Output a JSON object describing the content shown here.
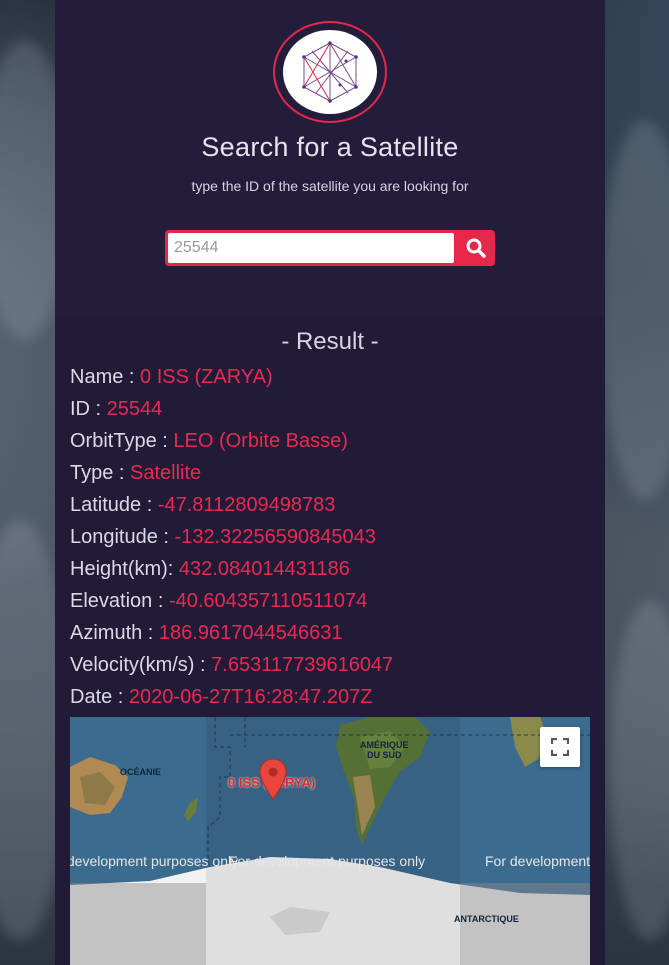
{
  "header": {
    "title": "Search for a Satellite",
    "subtitle": "type the ID of the satellite you are looking for"
  },
  "search": {
    "placeholder": "25544",
    "value": ""
  },
  "result": {
    "title": "- Result -",
    "fields": [
      {
        "key": "Name : ",
        "value": "0 ISS (ZARYA)"
      },
      {
        "key": "ID : ",
        "value": "25544"
      },
      {
        "key": "OrbitType : ",
        "value": "LEO (Orbite Basse)"
      },
      {
        "key": "Type : ",
        "value": "Satellite"
      },
      {
        "key": "Latitude : ",
        "value": "-47.8112809498783"
      },
      {
        "key": "Longitude : ",
        "value": "-132.32256590845043"
      },
      {
        "key": "Height(km): ",
        "value": "432.084014431186"
      },
      {
        "key": "Elevation : ",
        "value": "-40.604357110511074"
      },
      {
        "key": "Azimuth : ",
        "value": "186.9617044546631"
      },
      {
        "key": "Velocity(km/s) : ",
        "value": "7.653117739616047"
      },
      {
        "key": "Date : ",
        "value": "2020-06-27T16:28:47.207Z"
      }
    ]
  },
  "map": {
    "marker_label": "0 ISS (ZARYA)",
    "dev_notice": "For development purposes only",
    "labels": {
      "oceanie": "OCÉANIE",
      "amerique": "AMÉRIQUE\nDU SUD",
      "antarctique": "ANTARCTIQUE"
    }
  },
  "colors": {
    "accent": "#e5284a",
    "panel": "#221b38",
    "value_text": "#ec2850",
    "key_text": "#ddd8e6"
  },
  "icons": {
    "search": "search-icon",
    "fullscreen": "fullscreen-icon",
    "logo": "network-logo-icon",
    "marker": "map-marker-icon"
  }
}
